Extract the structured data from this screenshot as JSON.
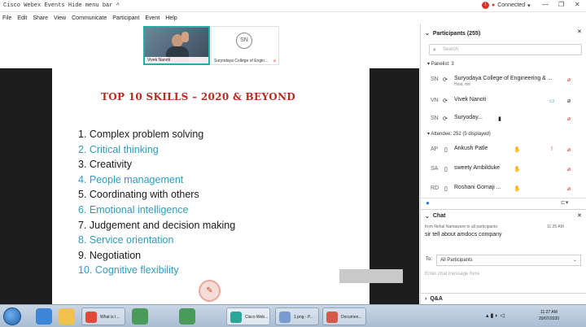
{
  "titlebar": {
    "title": "Cisco Webex Events  Hide menu bar ^",
    "connected": "Connected",
    "connected_dot": "!"
  },
  "menu": [
    "File",
    "Edit",
    "Share",
    "View",
    "Communicate",
    "Participant",
    "Event",
    "Help"
  ],
  "videos": {
    "presenter_label": "Vivek Nanoti",
    "tile_initials": "SN",
    "tile_label": "Suryodaya College of Engin..."
  },
  "slide": {
    "title": "TOP 10 SKILLS – 2020 & BEYOND",
    "skills": [
      "1. Complex problem solving",
      "2. Critical thinking",
      "3. Creativity",
      "4. People management",
      "5. Coordinating with others",
      "6. Emotional intelligence",
      "7. Judgement and decision making",
      "8. Service orientation",
      "9. Negotiation",
      "10. Cognitive flexibility"
    ],
    "skill_colors": {
      "dark": "#1a1a1a",
      "accent": "#2e9bbf"
    }
  },
  "participants": {
    "header": "Participants (255)",
    "search_placeholder": "Search",
    "panelists_label": "Panelist: 3",
    "attendees_label": "Attendee: 252 (5 displayed)",
    "panelists": [
      {
        "initials": "SN",
        "name": "Suryodaya College of Engineering & ...",
        "sub": "Host, me"
      },
      {
        "initials": "VN",
        "name": "Vivek Nanoti",
        "sub": ""
      },
      {
        "initials": "SN",
        "name": "Suryoday...",
        "sub": ""
      }
    ],
    "attendees": [
      {
        "initials": "AP",
        "name": "Ankush Patle"
      },
      {
        "initials": "SA",
        "name": "sweety Ambilduke"
      },
      {
        "initials": "RD",
        "name": "Roshani Gomaji ..."
      }
    ]
  },
  "chat": {
    "header": "Chat",
    "from": "from Nehal Namaware to all participants:",
    "time": "11:25 AM",
    "message": "sir tell about  amdocs  company",
    "to_label": "To:",
    "to_value": "All Participants",
    "input_placeholder": "Enter chat message here"
  },
  "qa": {
    "header": "Q&A"
  },
  "taskbar": {
    "items": [
      "What is I...",
      "Cisco Web...",
      "1.png - P...",
      "Documen..."
    ],
    "time": "11:27 AM",
    "date": "20/07/2020"
  }
}
